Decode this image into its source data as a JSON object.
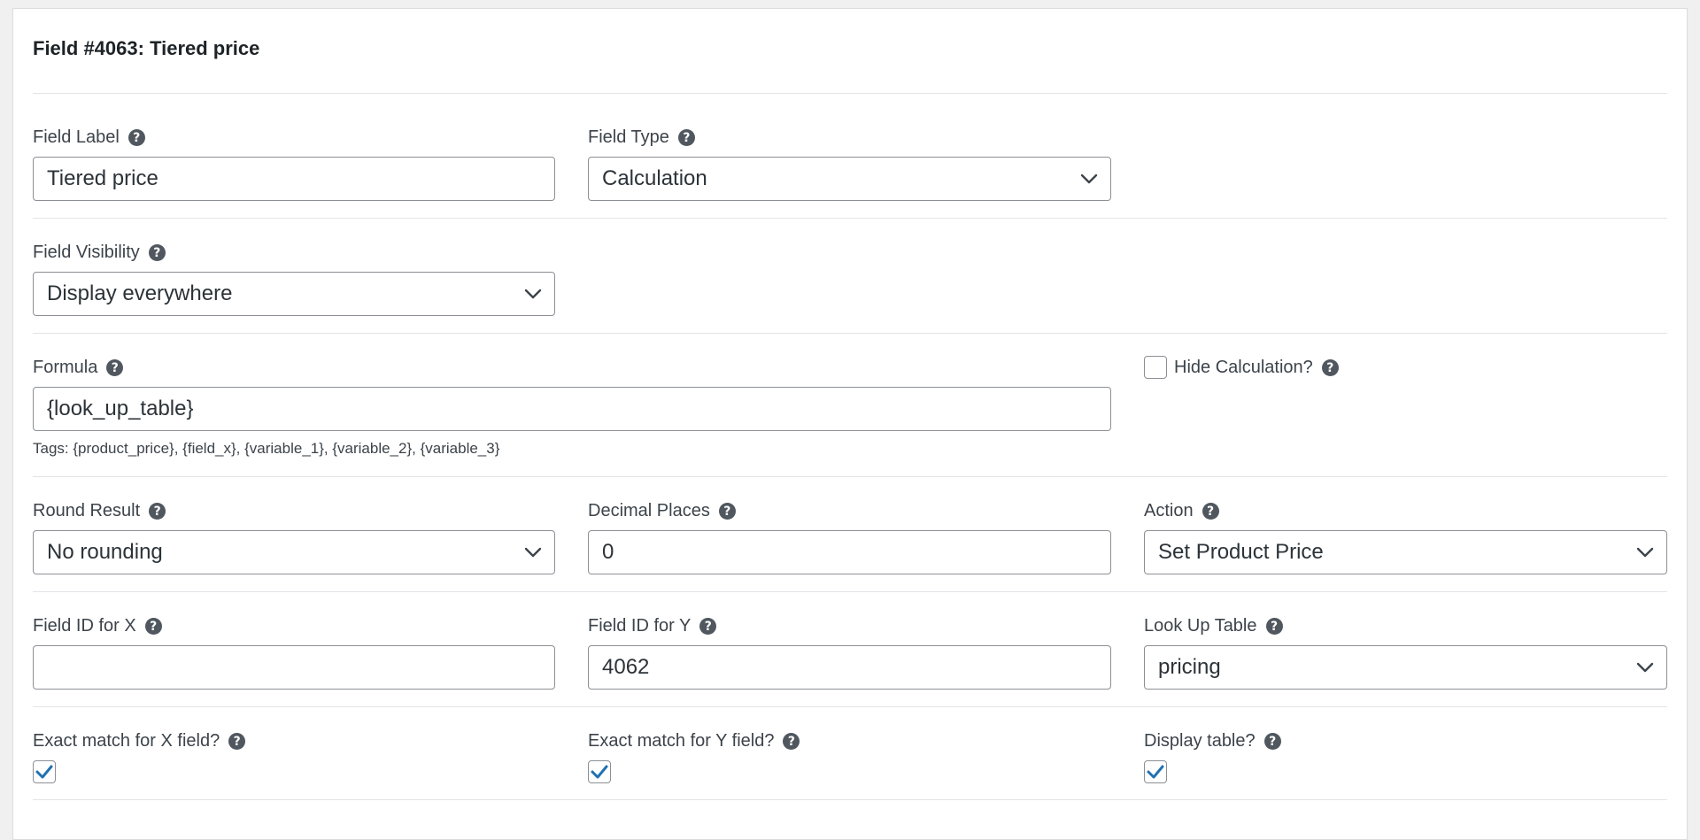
{
  "title": "Field #4063: Tiered price",
  "fields": {
    "field_label": {
      "label": "Field Label",
      "value": "Tiered price"
    },
    "field_type": {
      "label": "Field Type",
      "value": "Calculation"
    },
    "field_visibility": {
      "label": "Field Visibility",
      "value": "Display everywhere"
    },
    "formula": {
      "label": "Formula",
      "value": "{look_up_table}",
      "tags": "Tags: {product_price}, {field_x}, {variable_1}, {variable_2}, {variable_3}"
    },
    "hide_calculation": {
      "label": "Hide Calculation?",
      "checked": false
    },
    "round_result": {
      "label": "Round Result",
      "value": "No rounding"
    },
    "decimal_places": {
      "label": "Decimal Places",
      "value": "0"
    },
    "action": {
      "label": "Action",
      "value": "Set Product Price"
    },
    "field_id_x": {
      "label": "Field ID for X",
      "value": ""
    },
    "field_id_y": {
      "label": "Field ID for Y",
      "value": "4062"
    },
    "look_up_table": {
      "label": "Look Up Table",
      "value": "pricing"
    },
    "exact_match_x": {
      "label": "Exact match for X field?",
      "checked": true
    },
    "exact_match_y": {
      "label": "Exact match for Y field?",
      "checked": true
    },
    "display_table": {
      "label": "Display table?",
      "checked": true
    }
  },
  "icons": {
    "help": "help-icon",
    "chevron": "chevron-down-icon",
    "check": "check-icon"
  },
  "colors": {
    "check": "#2271b1",
    "help_bg": "#50575e",
    "border": "#8c8f94"
  }
}
